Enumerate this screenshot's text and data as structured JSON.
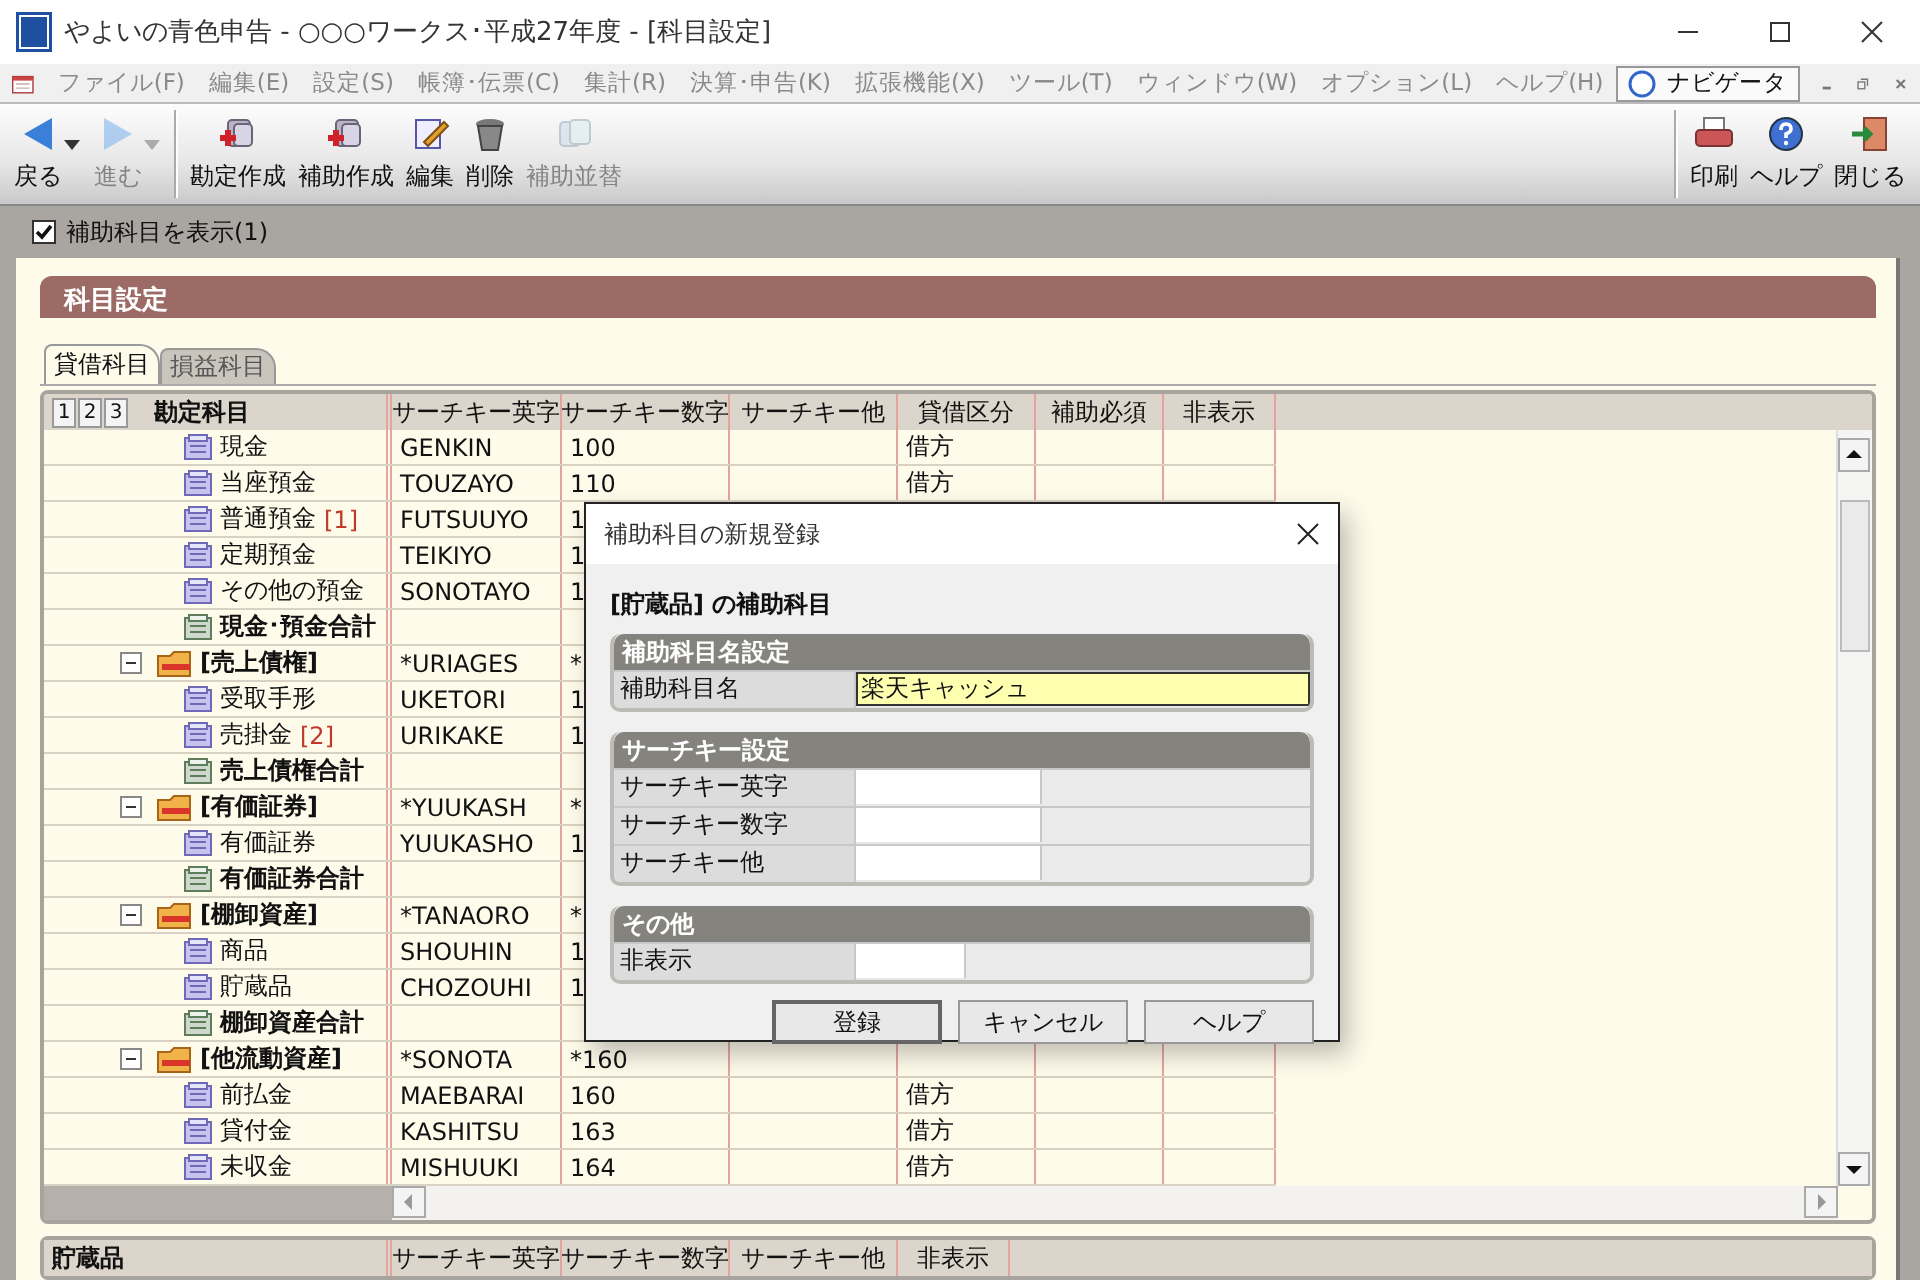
{
  "window": {
    "title": "やよいの青色申告 - ○○○ワークス･平成27年度 - [科目設定]"
  },
  "menu": [
    "ファイル(F)",
    "編集(E)",
    "設定(S)",
    "帳簿･伝票(C)",
    "集計(R)",
    "決算･申告(K)",
    "拡張機能(X)",
    "ツール(T)",
    "ウィンドウ(W)",
    "オプション(L)",
    "ヘルプ(H)"
  ],
  "navigator": {
    "label": "ナビゲータ"
  },
  "toolbar": {
    "nav": [
      {
        "label": "戻る",
        "disabled": false
      },
      {
        "label": "進む",
        "disabled": true
      }
    ],
    "actions": [
      {
        "label": "勘定作成",
        "disabled": false
      },
      {
        "label": "補助作成",
        "disabled": false
      },
      {
        "label": "編集",
        "disabled": false
      },
      {
        "label": "削除",
        "disabled": false
      },
      {
        "label": "補助並替",
        "disabled": true
      }
    ],
    "right": [
      {
        "label": "印刷",
        "disabled": false
      },
      {
        "label": "ヘルプ",
        "disabled": false
      },
      {
        "label": "閉じる",
        "disabled": false
      }
    ]
  },
  "show_sub_accounts": {
    "label": "補助科目を表示(1)",
    "checked": true
  },
  "heading": "科目設定",
  "tabs": [
    {
      "label": "貸借科目",
      "selected": true
    },
    {
      "label": "損益科目",
      "selected": false
    }
  ],
  "grid": {
    "levels": [
      "1",
      "2",
      "3"
    ],
    "columns": [
      "勘定科目",
      "サーチキー英字",
      "サーチキー数字",
      "サーチキー他",
      "貸借区分",
      "補助必須",
      "非表示"
    ],
    "rows": [
      {
        "kind": "account",
        "name": "現金",
        "en": "GENKIN",
        "num": "100",
        "dc": "借方"
      },
      {
        "kind": "account",
        "name": "当座預金",
        "en": "TOUZAYO",
        "num": "110",
        "dc": "借方"
      },
      {
        "kind": "account",
        "name": "普通預金",
        "count": "[1]",
        "en": "FUTSUUYO",
        "num": "1"
      },
      {
        "kind": "account",
        "name": "定期預金",
        "en": "TEIKIYO",
        "num": "1"
      },
      {
        "kind": "account",
        "name": "その他の預金",
        "en": "SONOTAYO",
        "num": "1"
      },
      {
        "kind": "total",
        "name": "現金･預金合計"
      },
      {
        "kind": "group",
        "name": "[売上債権]",
        "en": "*URIAGES",
        "num": "*",
        "expanded": true,
        "children": [
          {
            "kind": "account",
            "name": "受取手形",
            "en": "UKETORI",
            "num": "1"
          },
          {
            "kind": "account",
            "name": "売掛金",
            "count": "[2]",
            "en": "URIKAKE",
            "num": "1"
          },
          {
            "kind": "total",
            "name": "売上債権合計"
          }
        ]
      },
      {
        "kind": "group",
        "name": "[有価証券]",
        "en": "*YUUKASH",
        "num": "*",
        "expanded": true,
        "children": [
          {
            "kind": "account",
            "name": "有価証券",
            "en": "YUUKASHO",
            "num": "1"
          },
          {
            "kind": "total",
            "name": "有価証券合計"
          }
        ]
      },
      {
        "kind": "group",
        "name": "[棚卸資産]",
        "en": "*TANAORO",
        "num": "*",
        "expanded": true,
        "children": [
          {
            "kind": "account",
            "name": "商品",
            "en": "SHOUHIN",
            "num": "1"
          },
          {
            "kind": "account",
            "name": "貯蔵品",
            "en": "CHOZOUHI",
            "num": "1"
          },
          {
            "kind": "total",
            "name": "棚卸資産合計"
          }
        ]
      },
      {
        "kind": "group",
        "name": "[他流動資産]",
        "en": "*SONOTA",
        "num": "*160",
        "expanded": true,
        "children": [
          {
            "kind": "account",
            "name": "前払金",
            "en": "MAEBARAI",
            "num": "160",
            "dc": "借方"
          },
          {
            "kind": "account",
            "name": "貸付金",
            "en": "KASHITSU",
            "num": "163",
            "dc": "借方"
          },
          {
            "kind": "account",
            "name": "未収金",
            "en": "MISHUUKI",
            "num": "164",
            "dc": "借方"
          }
        ]
      }
    ]
  },
  "second_grid": {
    "columns": [
      "貯蔵品",
      "サーチキー英字",
      "サーチキー数字",
      "サーチキー他",
      "非表示"
    ]
  },
  "dialog": {
    "title": "補助科目の新規登録",
    "heading": "[貯蔵品] の補助科目",
    "sections": [
      {
        "title": "補助科目名設定",
        "fields": [
          {
            "label": "補助科目名",
            "kind": "name",
            "value": "楽天キャッシュ",
            "focused": true
          }
        ]
      },
      {
        "title": "サーチキー設定",
        "fields": [
          {
            "label": "サーチキー英字",
            "kind": "key",
            "focused": false
          },
          {
            "label": "サーチキー数字",
            "kind": "key",
            "focused": false
          },
          {
            "label": "サーチキー他",
            "kind": "key",
            "focused": false
          }
        ]
      },
      {
        "title": "その他",
        "fields": [
          {
            "label": "非表示",
            "kind": "flag",
            "focused": false
          }
        ]
      }
    ],
    "buttons": [
      {
        "label": "登録",
        "default": true
      },
      {
        "label": "キャンセル",
        "default": false
      },
      {
        "label": "ヘルプ",
        "default": false
      }
    ]
  }
}
